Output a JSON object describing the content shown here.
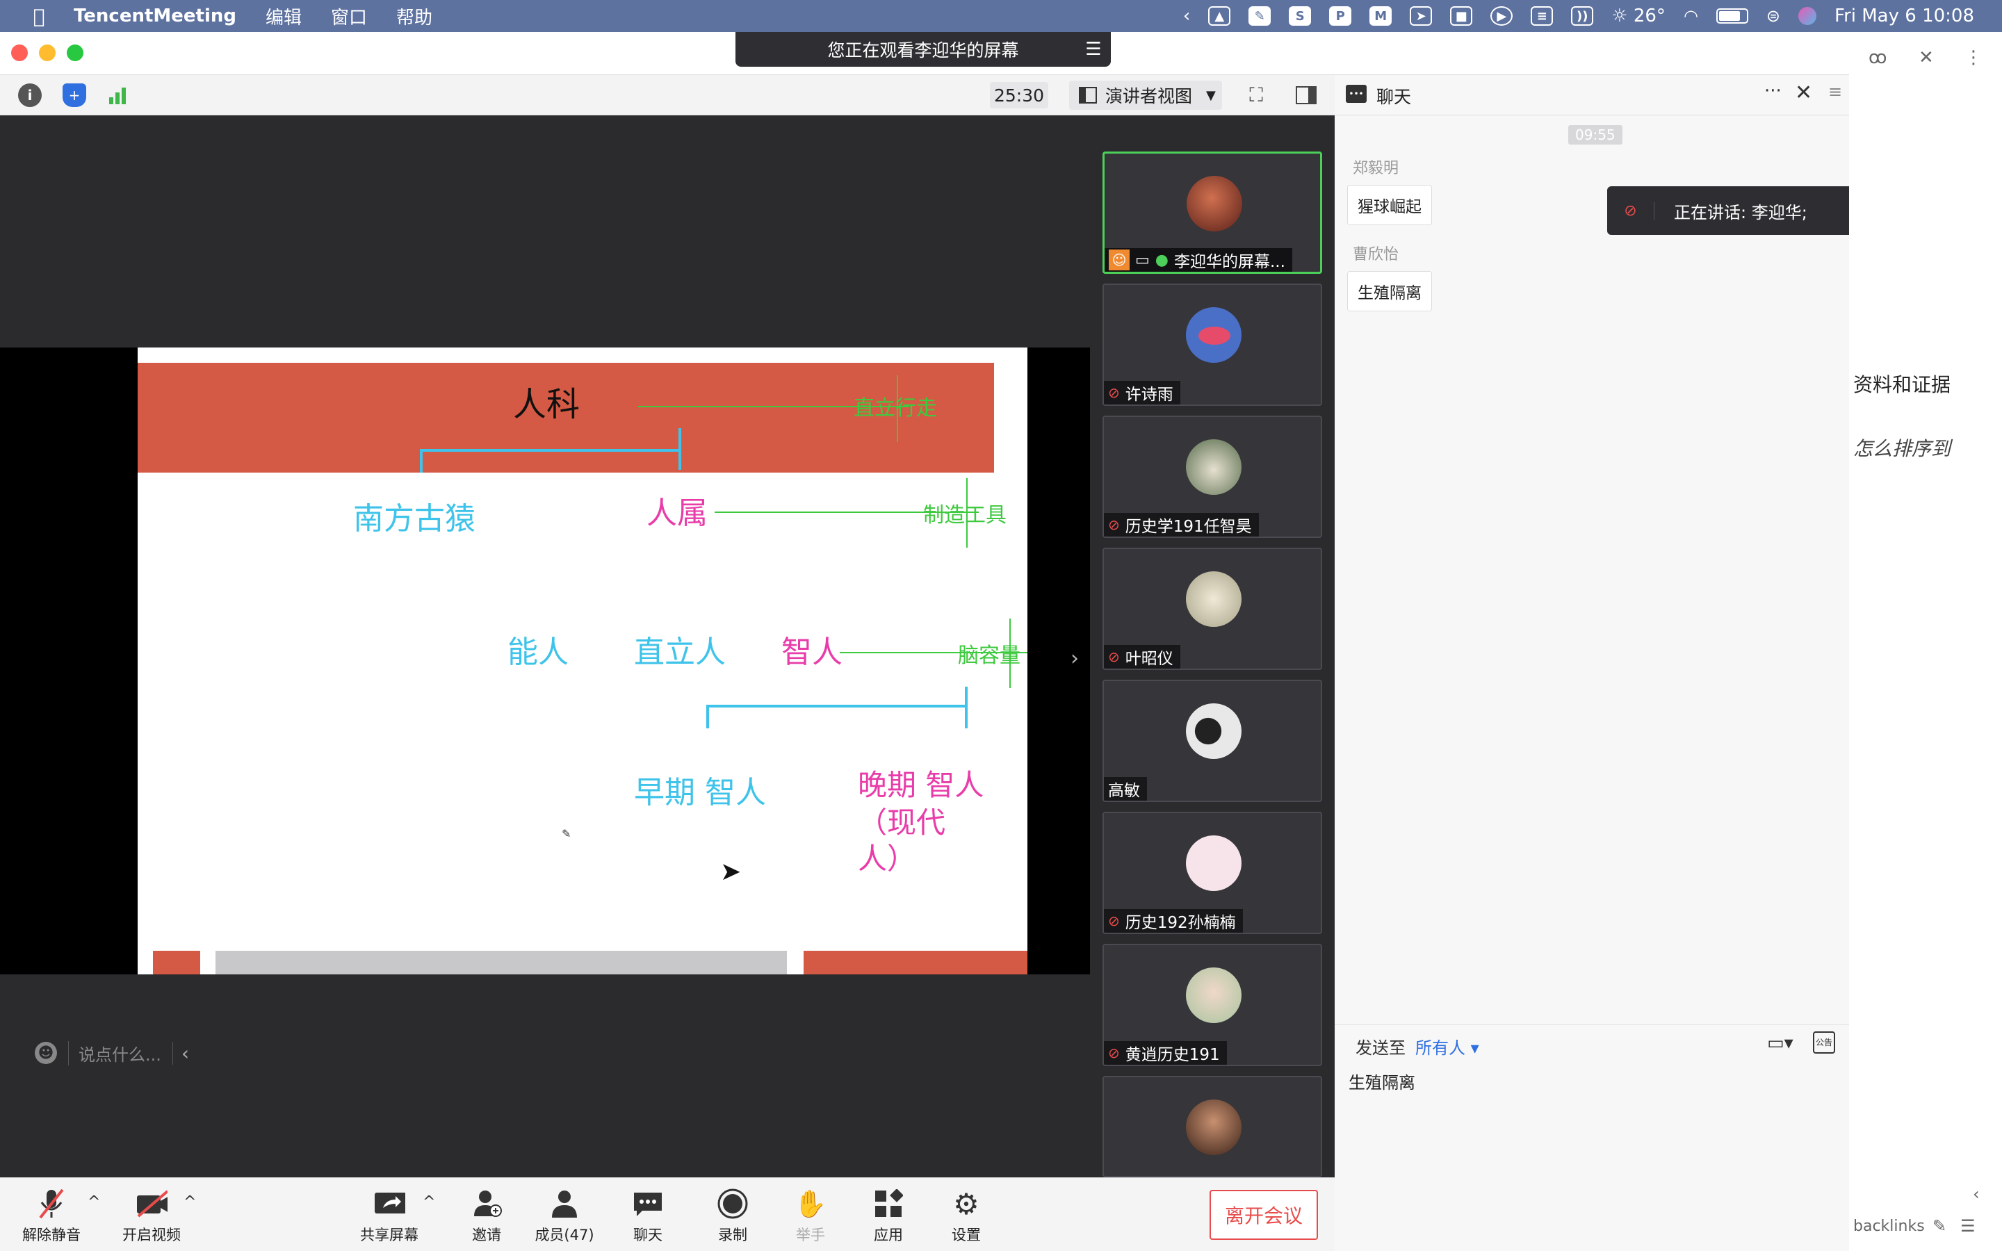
{
  "menubar": {
    "app": "TencentMeeting",
    "items": [
      "编辑",
      "窗口",
      "帮助"
    ],
    "temperature": "26°",
    "datetime": "Fri May 6  10:08"
  },
  "banner": {
    "text": "您正在观看李迎华的屏幕"
  },
  "toolbar": {
    "timer": "25:30",
    "view": "演讲者视图"
  },
  "slide": {
    "title": "人科",
    "label_upright": "直立行走",
    "label_australopith": "南方古猿",
    "label_homo": "人属",
    "label_tools": "制造工具",
    "label_habilis": "能人",
    "label_erectus": "直立人",
    "label_sapiens": "智人",
    "label_brain": "脑容量",
    "label_early": "早期 智人",
    "label_late_1": "晚期 智人",
    "label_late_2": "（现代",
    "label_late_3": "人）"
  },
  "chat_input": {
    "placeholder": "说点什么..."
  },
  "participants": [
    {
      "name": "李迎华的屏幕...",
      "color": "#8b3a2c"
    },
    {
      "name": "许诗雨",
      "color": "#4a6fc7"
    },
    {
      "name": "历史学191任智昊",
      "color": "#b6c0b4"
    },
    {
      "name": "叶昭仪",
      "color": "#c9c2a5"
    },
    {
      "name": "高敏",
      "color": "#dcdcdc"
    },
    {
      "name": "历史192孙楠楠",
      "color": "#f6e4ea"
    },
    {
      "name": "黄逍历史191",
      "color": "#c9d7c3"
    },
    {
      "name": "",
      "color": "#6b4a3a"
    }
  ],
  "bottombar": {
    "mute": "解除静音",
    "video": "开启视频",
    "share": "共享屏幕",
    "invite": "邀请",
    "members": "成员(47)",
    "chat": "聊天",
    "record": "录制",
    "raise_hand": "举手",
    "apps": "应用",
    "settings": "设置",
    "leave": "离开会议"
  },
  "chat": {
    "title": "聊天",
    "time": "09:55",
    "messages": [
      {
        "sender": "郑毅明",
        "text": "猩球崛起"
      },
      {
        "sender": "曹欣怡",
        "text": "生殖隔离"
      }
    ],
    "send_to_label": "发送至",
    "send_to_value": "所有人",
    "draft": "生殖隔离",
    "speaking": "正在讲话: 李迎华;"
  },
  "bg_window": {
    "text1": "资料和证据",
    "text2": "怎么排序到",
    "text3": "backlinks"
  }
}
